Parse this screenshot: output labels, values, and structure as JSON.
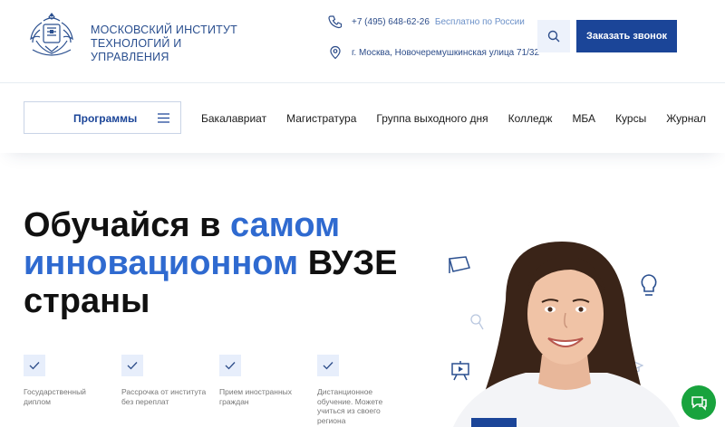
{
  "brand": {
    "line1": "МОСКОВСКИЙ ИНСТИТУТ",
    "line2": "ТЕХНОЛОГИЙ И УПРАВЛЕНИЯ"
  },
  "contacts": {
    "phone": "+7 (495) 648-62-26",
    "phone_note": "Бесплатно по России",
    "address": "г. Москва, Новочеремушкинская улица 71/32"
  },
  "header": {
    "search_icon": "search-icon",
    "call_button": "Заказать звонок"
  },
  "nav": {
    "programs_label": "Программы",
    "links": [
      "Бакалавриат",
      "Магистратура",
      "Группа выходного дня",
      "Колледж",
      "МБА",
      "Курсы",
      "Журнал"
    ]
  },
  "hero": {
    "part1": "Обучайся в ",
    "part2": "самом инновационном",
    "part3": " ВУЗЕ страны"
  },
  "features": [
    "Государственный диплом",
    "Рассрочка от института без переплат",
    "Прием иностранных граждан",
    "Дистанционное обучение. Можете учиться из своего региона"
  ],
  "colors": {
    "primary": "#1b4598",
    "accent_blue": "#2f6ad0",
    "chat_green": "#18a33d",
    "check_bg": "#e7eefb"
  }
}
